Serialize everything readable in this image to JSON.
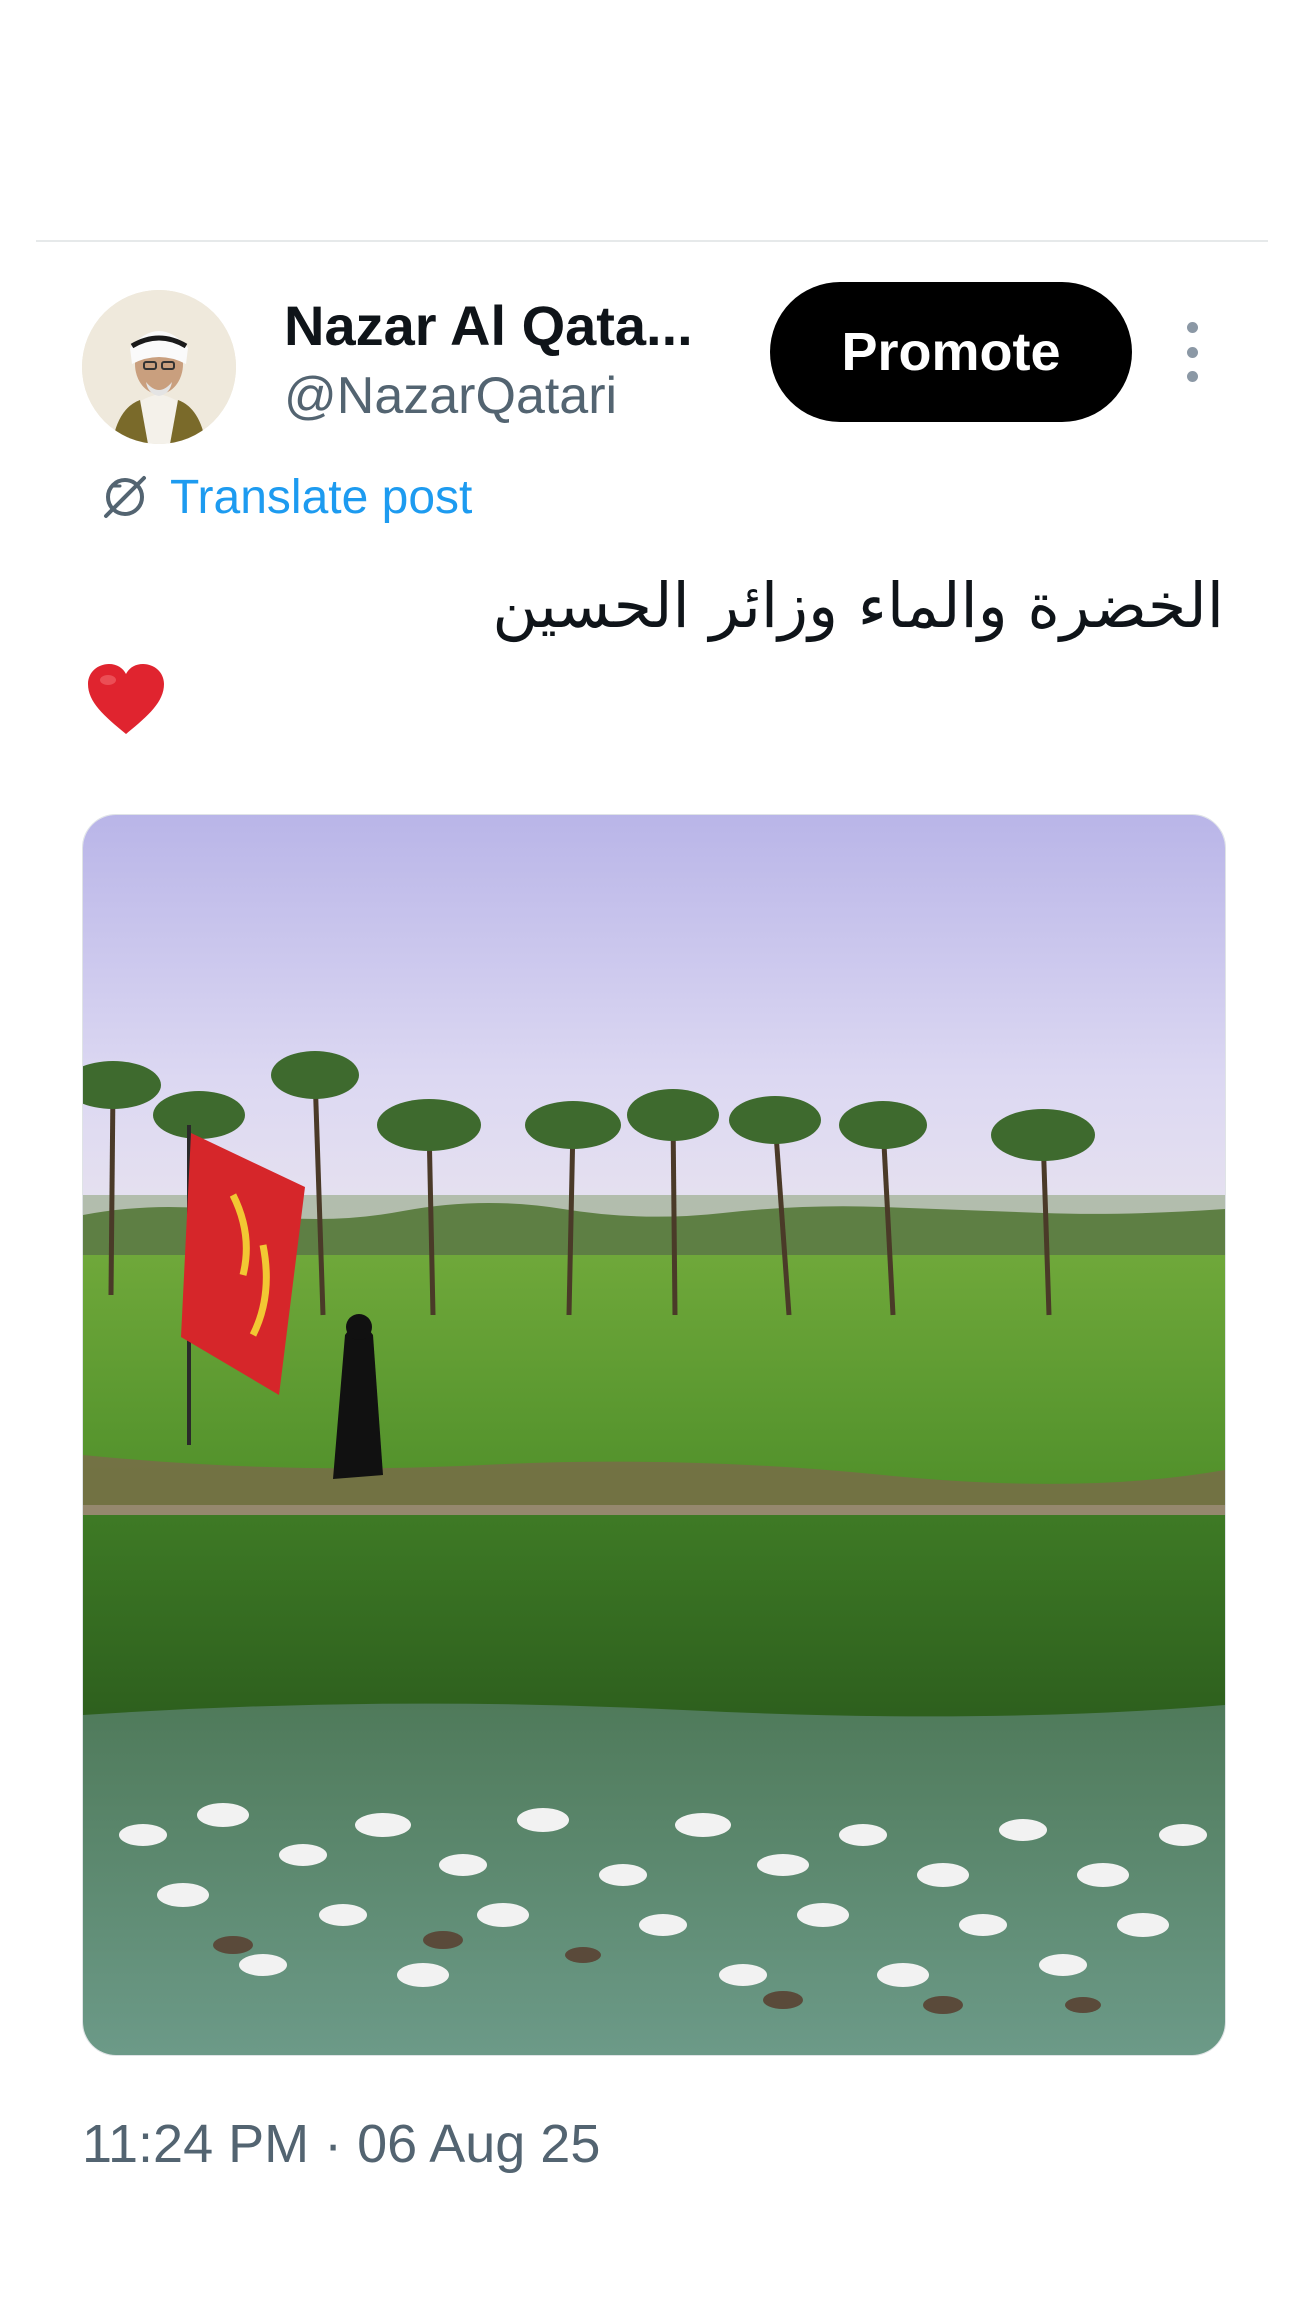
{
  "post": {
    "author": {
      "display_name": "Nazar Al Qata...",
      "handle": "@NazarQatari",
      "avatar_icon": "profile-avatar"
    },
    "promote_label": "Promote",
    "more_icon": "vertical-ellipsis-icon",
    "translate_label": "Translate post",
    "translate_icon": "translate-globe-icon",
    "text": "الخضرة والماء وزائر الحسين",
    "emoji": "heart-emoji",
    "timestamp": "11:24 PM · 06 Aug 25"
  },
  "colors": {
    "text_primary": "#0f1419",
    "text_secondary": "#536471",
    "link": "#1d9bf0",
    "button_bg": "#000000",
    "button_text": "#ffffff",
    "heart": "#e0242f"
  }
}
